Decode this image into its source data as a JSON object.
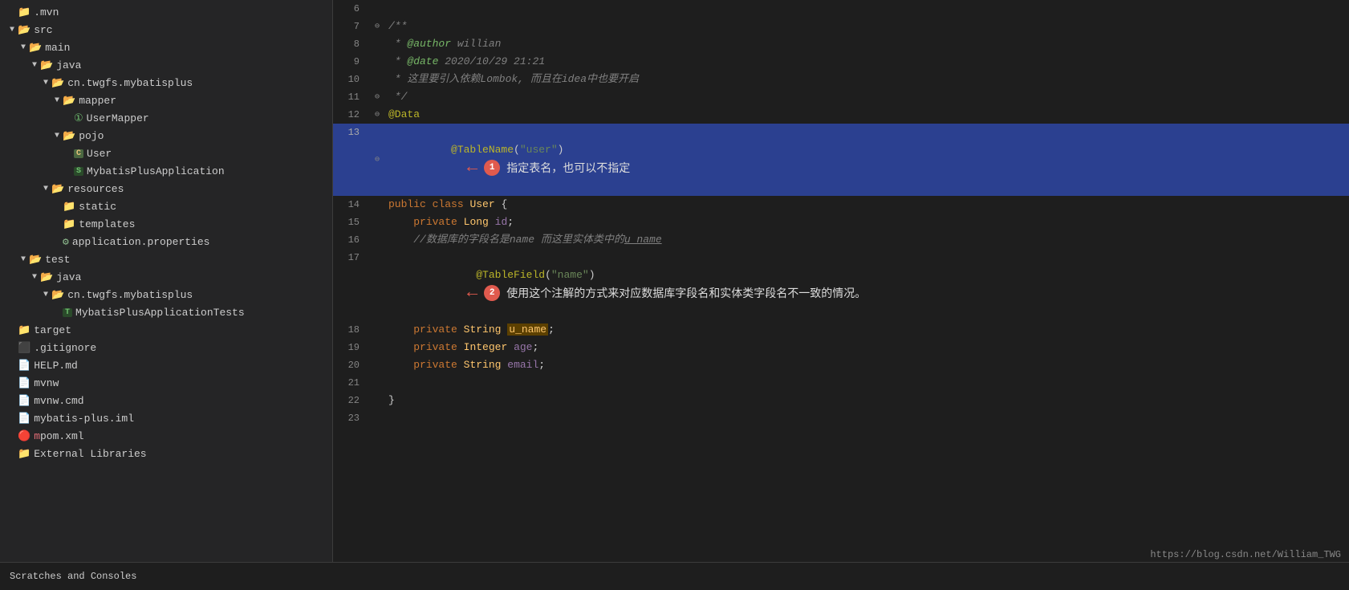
{
  "sidebar": {
    "items": [
      {
        "id": "mvn",
        "label": ".mvn",
        "level": 0,
        "type": "folder",
        "arrow": "none",
        "state": "closed"
      },
      {
        "id": "src",
        "label": "src",
        "level": 0,
        "type": "folder",
        "arrow": "open",
        "state": "open"
      },
      {
        "id": "main",
        "label": "main",
        "level": 1,
        "type": "folder",
        "arrow": "open",
        "state": "open"
      },
      {
        "id": "java",
        "label": "java",
        "level": 2,
        "type": "folder",
        "arrow": "open",
        "state": "open"
      },
      {
        "id": "cn.twgfs.mybatisplus",
        "label": "cn.twgfs.mybatisplus",
        "level": 3,
        "type": "folder",
        "arrow": "open",
        "state": "open"
      },
      {
        "id": "mapper",
        "label": "mapper",
        "level": 4,
        "type": "folder",
        "arrow": "open",
        "state": "open"
      },
      {
        "id": "UserMapper",
        "label": "UserMapper",
        "level": 5,
        "type": "mapper",
        "arrow": "none"
      },
      {
        "id": "pojo",
        "label": "pojo",
        "level": 4,
        "type": "folder",
        "arrow": "open",
        "state": "open"
      },
      {
        "id": "User",
        "label": "User",
        "level": 5,
        "type": "class",
        "arrow": "none"
      },
      {
        "id": "MybatisPlusApplication",
        "label": "MybatisPlusApplication",
        "level": 5,
        "type": "spring",
        "arrow": "none"
      },
      {
        "id": "resources",
        "label": "resources",
        "level": 3,
        "type": "folder",
        "arrow": "open",
        "state": "open"
      },
      {
        "id": "static",
        "label": "static",
        "level": 4,
        "type": "folder",
        "arrow": "none"
      },
      {
        "id": "templates",
        "label": "templates",
        "level": 4,
        "type": "folder",
        "arrow": "none"
      },
      {
        "id": "application.properties",
        "label": "application.properties",
        "level": 4,
        "type": "props",
        "arrow": "none"
      },
      {
        "id": "test",
        "label": "test",
        "level": 1,
        "type": "folder",
        "arrow": "open",
        "state": "open"
      },
      {
        "id": "java2",
        "label": "java",
        "level": 2,
        "type": "folder",
        "arrow": "open",
        "state": "open"
      },
      {
        "id": "cn.twgfs.mybatisplus2",
        "label": "cn.twgfs.mybatisplus",
        "level": 3,
        "type": "folder",
        "arrow": "open",
        "state": "open"
      },
      {
        "id": "MybatisPlusApplicationTests",
        "label": "MybatisPlusApplicationTests",
        "level": 4,
        "type": "test",
        "arrow": "none"
      },
      {
        "id": "target",
        "label": "target",
        "level": 0,
        "type": "target",
        "arrow": "none"
      },
      {
        "id": ".gitignore",
        "label": ".gitignore",
        "level": 0,
        "type": "gitignore",
        "arrow": "none"
      },
      {
        "id": "HELP.md",
        "label": "HELP.md",
        "level": 0,
        "type": "md",
        "arrow": "none"
      },
      {
        "id": "mvnw",
        "label": "mvnw",
        "level": 0,
        "type": "file",
        "arrow": "none"
      },
      {
        "id": "mvnw.cmd",
        "label": "mvnw.cmd",
        "level": 0,
        "type": "file",
        "arrow": "none"
      },
      {
        "id": "mybatis-plus.iml",
        "label": "mybatis-plus.iml",
        "level": 0,
        "type": "iml",
        "arrow": "none"
      },
      {
        "id": "pom.xml",
        "label": "pom.xml",
        "level": 0,
        "type": "xml",
        "arrow": "none"
      }
    ]
  },
  "external_libraries": "External Libraries",
  "scratches_label": "Scratches and Consoles",
  "url": "https://blog.csdn.net/William_TWG",
  "annotation1_text": "指定表名，也可以不指定",
  "annotation2_text": "使用这个注解的方式来对应数据库字段名和实体类字段名不一致的情况。",
  "code_lines": [
    {
      "num": 6,
      "content": "",
      "gutter": ""
    },
    {
      "num": 7,
      "content": "/**",
      "gutter": "fold"
    },
    {
      "num": 8,
      "content": " * @author willian",
      "gutter": ""
    },
    {
      "num": 9,
      "content": " * @date 2020/10/29 21:21",
      "gutter": ""
    },
    {
      "num": 10,
      "content": " * 这里要引入依赖Lombok, 而且在idea中也要开启",
      "gutter": ""
    },
    {
      "num": 11,
      "content": " */",
      "gutter": "fold"
    },
    {
      "num": 12,
      "content": "@Data",
      "gutter": "fold"
    },
    {
      "num": 13,
      "content": "@TableName(\"user\")",
      "gutter": "fold",
      "highlighted": true
    },
    {
      "num": 14,
      "content": "public class User {",
      "gutter": ""
    },
    {
      "num": 15,
      "content": "    private Long id;",
      "gutter": ""
    },
    {
      "num": 16,
      "content": "    //数据库的字段名是name 而这里实体类中的u_name",
      "gutter": ""
    },
    {
      "num": 17,
      "content": "    @TableField(\"name\")",
      "gutter": ""
    },
    {
      "num": 18,
      "content": "    private String u_name;",
      "gutter": ""
    },
    {
      "num": 19,
      "content": "    private Integer age;",
      "gutter": ""
    },
    {
      "num": 20,
      "content": "    private String email;",
      "gutter": ""
    },
    {
      "num": 21,
      "content": "",
      "gutter": ""
    },
    {
      "num": 22,
      "content": "}",
      "gutter": ""
    },
    {
      "num": 23,
      "content": "",
      "gutter": ""
    }
  ]
}
